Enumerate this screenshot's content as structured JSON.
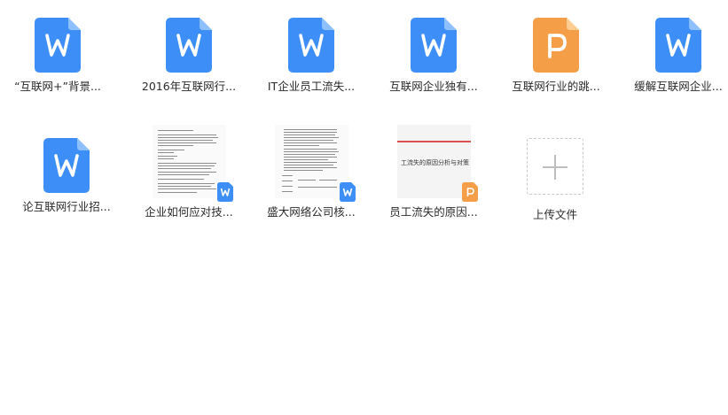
{
  "colors": {
    "word_blue": "#3d8ef7",
    "ppt_orange": "#f49f47"
  },
  "files_row1": [
    {
      "name": "“互联网+”背景...",
      "icon": "word-icon"
    },
    {
      "name": "2016年互联网行...",
      "icon": "word-icon"
    },
    {
      "name": "IT企业员工流失...",
      "icon": "word-icon"
    },
    {
      "name": "互联网企业独有...",
      "icon": "word-icon"
    },
    {
      "name": "互联网行业的跳...",
      "icon": "ppt-icon"
    },
    {
      "name": "缓解互联网企业...",
      "icon": "word-icon"
    }
  ],
  "files_row2": [
    {
      "name": "论互联网行业招...",
      "icon": "word-icon"
    },
    {
      "name": "企业如何应对技...",
      "icon": "word-thumbnail"
    },
    {
      "name": "盛大网络公司核...",
      "icon": "word-thumbnail"
    },
    {
      "name": "员工流失的原因...",
      "icon": "ppt-thumbnail",
      "preview_title": "工流失的原因分析与对策"
    }
  ],
  "upload": {
    "label": "上传文件",
    "icon": "plus-icon"
  }
}
